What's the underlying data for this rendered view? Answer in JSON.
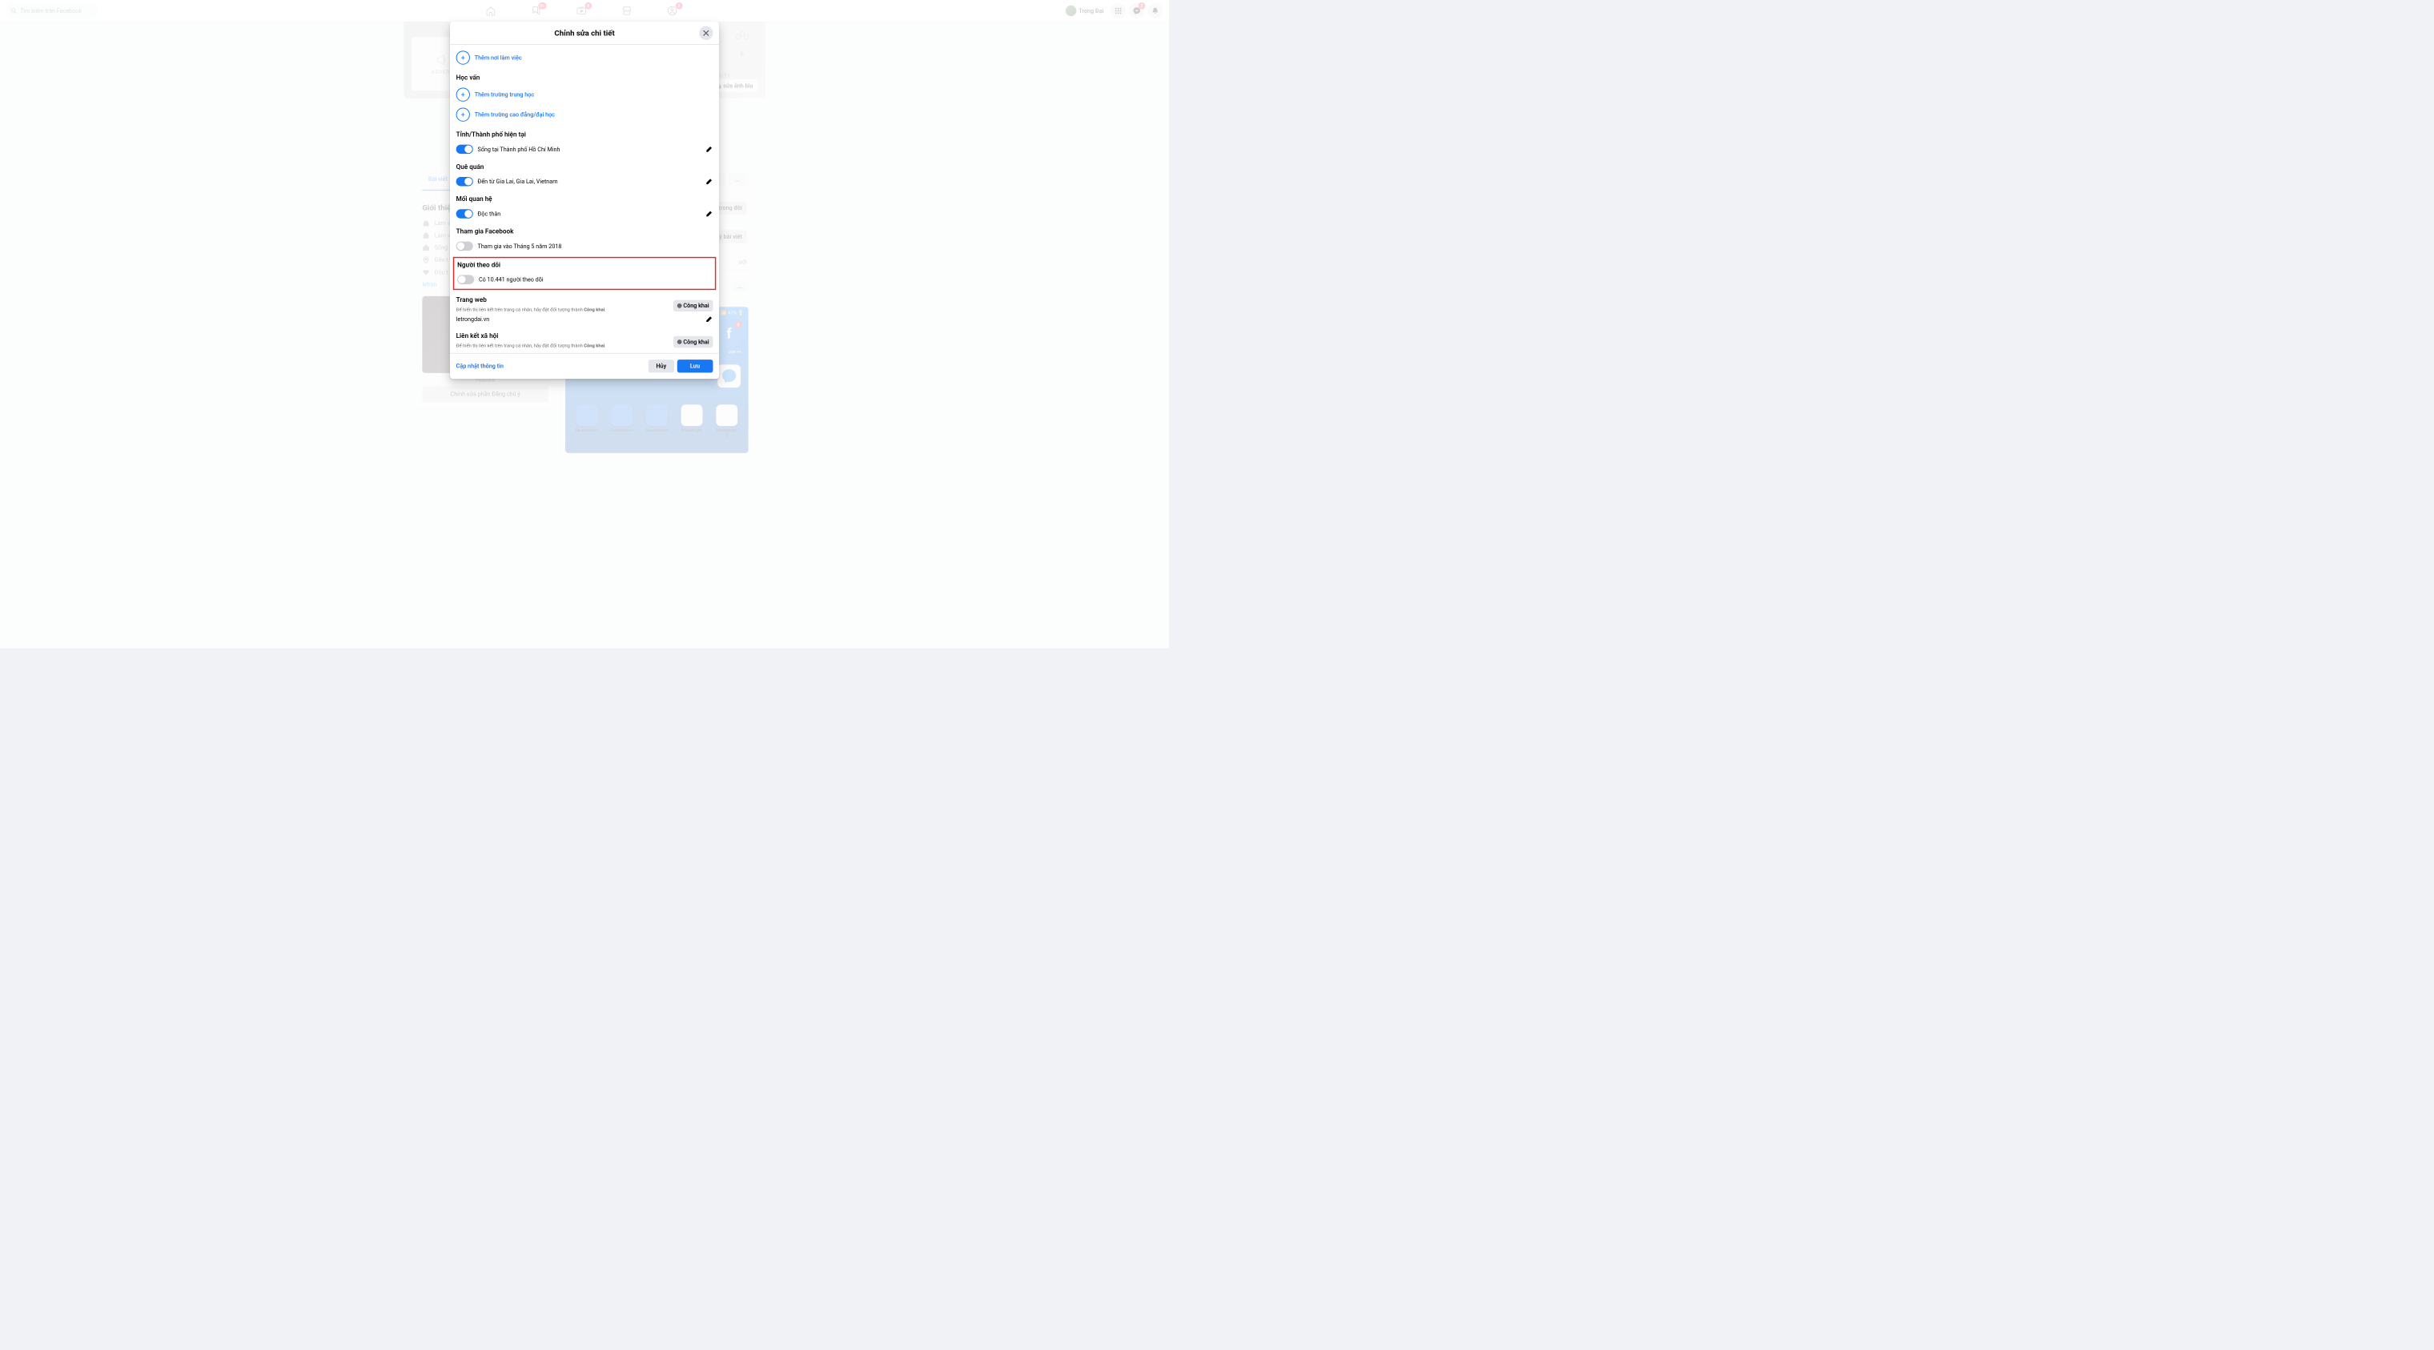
{
  "header": {
    "search_placeholder": "Tìm kiếm trên Facebook",
    "profile_name": "Trọng Đại",
    "badges": {
      "friends": "9+",
      "watch": "8",
      "groups": "2",
      "messenger": "2"
    }
  },
  "background": {
    "cover_edit": "sửa ảnh bìa",
    "community_label": "MUNITY",
    "advert_label": "ADVERT",
    "tabs": {
      "posts": "Bài viết",
      "more_tab": "án",
      "more": "..."
    },
    "intro": {
      "title": "Giới thiệu",
      "lines": [
        "Làm v",
        "Làm v",
        "Sống",
        "Đến t",
        "Độc t",
        "letron"
      ]
    },
    "featured": {
      "caption": "Feature",
      "edit": "Chỉnh sửa phần Đăng chú ý"
    },
    "right": {
      "card1": "trong đời",
      "card2": "ý bài viết",
      "card3": "ưới",
      "app_labels": [
        "Facebook++",
        "Facebook++",
        "Facebook++",
        "Messenger",
        "Messenger 2"
      ],
      "battery": "41%",
      "app_tile": "ook ++"
    }
  },
  "modal": {
    "title": "Chỉnh sửa chi tiết",
    "close": "×",
    "sections": {
      "work_add": "Thêm nơi làm việc",
      "education": "Học vấn",
      "edu_high": "Thêm trường trung học",
      "edu_college": "Thêm trường cao đẳng/đại học",
      "city": "Tỉnh/Thành phố hiện tại",
      "city_val": "Sống tại Thành phố Hồ Chí Minh",
      "hometown": "Quê quán",
      "hometown_val": "Đến từ Gia Lai, Gia Lai, Vietnam",
      "relationship": "Mối quan hệ",
      "relationship_val": "Độc thân",
      "joined": "Tham gia Facebook",
      "joined_val": "Tham gia vào Tháng 5 năm 2018",
      "followers": "Người theo dõi",
      "followers_val": "Có 10.441 người theo dõi",
      "website": "Trang web",
      "website_hint_a": "Để hiển thị liên kết trên trang cá nhân, hãy đặt đối tượng thành ",
      "website_hint_b": "Công khai",
      "website_val": "letrongdai.vn",
      "social": "Liên kết xã hội",
      "social_hint_a": "Để hiển thị liên kết trên trang cá nhân, hãy đặt đối tượng thành ",
      "social_hint_b": "Công khai",
      "public_btn": "Công khai"
    },
    "footer": {
      "update": "Cập nhật thông tin",
      "cancel": "Hủy",
      "save": "Lưu"
    }
  }
}
